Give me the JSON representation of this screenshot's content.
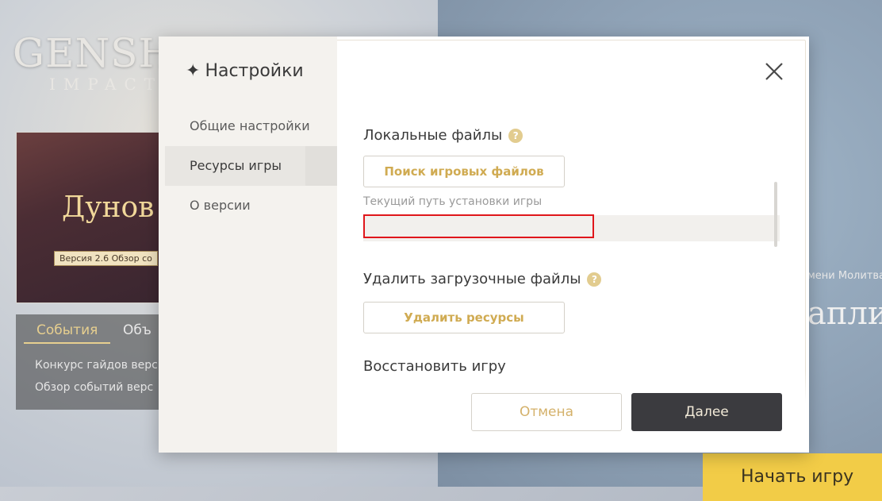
{
  "background": {
    "logo": "GENSHIN",
    "logo_sub": "IMPACT",
    "banner_title": "Дунов фиалков",
    "banner_tag": "Версия 2.6  Обзор со",
    "tabs": {
      "active": "События",
      "other": "Объ"
    },
    "events": [
      "Конкурс гайдов верс",
      "Обзор событий верс"
    ],
    "right_text_small": "мени Молитва",
    "right_text_big": "апли",
    "start_button": "Начать игру"
  },
  "modal": {
    "title": "Настройки",
    "nav": [
      {
        "label": "Общие настройки",
        "active": false
      },
      {
        "label": "Ресурсы игры",
        "active": true
      },
      {
        "label": "О версии",
        "active": false
      }
    ],
    "sections": {
      "local_files": {
        "title": "Локальные файлы",
        "button": "Поиск игровых файлов",
        "path_label": "Текущий путь установки игры",
        "path_value": ""
      },
      "delete_files": {
        "title": "Удалить загрузочные файлы",
        "button": "Удалить ресурсы"
      },
      "restore": {
        "title": "Восстановить игру"
      }
    },
    "footer": {
      "cancel": "Отмена",
      "next": "Далее"
    }
  },
  "colors": {
    "accent_gold": "#d0ab52",
    "dark_button": "#3b3b3f",
    "highlight_red": "#e0161b",
    "start_yellow": "#f2cc47"
  }
}
